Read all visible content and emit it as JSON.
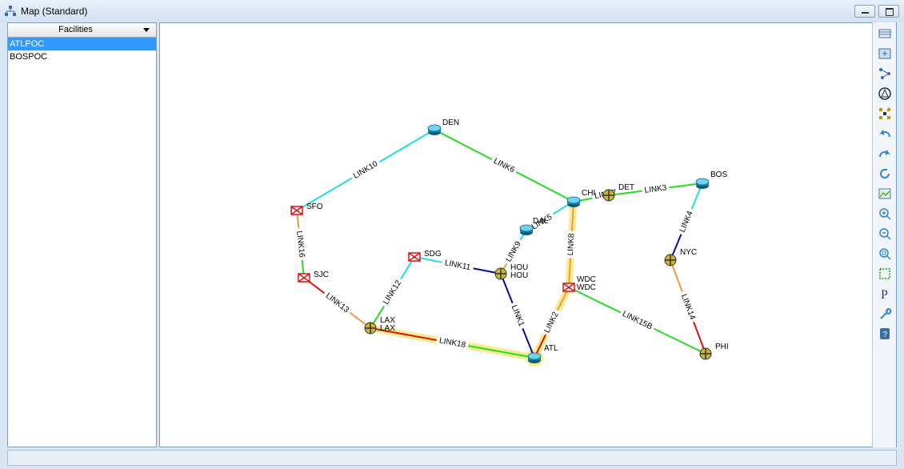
{
  "window": {
    "title": "Map (Standard)"
  },
  "facilities": {
    "dropdown_label": "Facilities",
    "items": [
      "ATLPOC",
      "BOSPOC"
    ],
    "selected": "ATLPOC"
  },
  "colors": {
    "green": "#22dd22",
    "cyan": "#22dddd",
    "blue": "#0a0a99",
    "orange": "#f09a40",
    "red": "#dd1111",
    "highlight": "#f7ec90",
    "selection": "#3399ff"
  },
  "map": {
    "nodes": [
      {
        "id": "DEN",
        "label": "DEN",
        "type": "router"
      },
      {
        "id": "SFO",
        "label": "SFO",
        "type": "switch"
      },
      {
        "id": "SJC",
        "label": "SJC",
        "type": "switch"
      },
      {
        "id": "LAX",
        "label": "LAX",
        "label2": "LAX",
        "type": "cross"
      },
      {
        "id": "SDG",
        "label": "SDG",
        "type": "switch"
      },
      {
        "id": "HOU",
        "label": "HOU",
        "label2": "HOU",
        "type": "cross"
      },
      {
        "id": "DAL",
        "label": "DAL",
        "type": "router"
      },
      {
        "id": "CHI",
        "label": "CHI",
        "type": "router"
      },
      {
        "id": "DET",
        "label": "DET",
        "type": "cross"
      },
      {
        "id": "BOS",
        "label": "BOS",
        "type": "router"
      },
      {
        "id": "NYC",
        "label": "NYC",
        "type": "cross"
      },
      {
        "id": "WDC",
        "label": "WDC",
        "label2": "WDC",
        "type": "switch"
      },
      {
        "id": "ATL",
        "label": "ATL",
        "type": "router"
      },
      {
        "id": "PHI",
        "label": "PHI",
        "type": "cross"
      }
    ],
    "links": [
      {
        "name": "LINK10",
        "from": "SFO",
        "to": "DEN",
        "color": "cyan"
      },
      {
        "name": "LINK6",
        "from": "DEN",
        "to": "CHI",
        "color": "green"
      },
      {
        "name": "LINK16",
        "from": "SFO",
        "to": "SJC",
        "color": "orange",
        "color2": "green"
      },
      {
        "name": "LINK13",
        "from": "SJC",
        "to": "LAX",
        "color": "red",
        "color2": "orange"
      },
      {
        "name": "LINK12",
        "from": "LAX",
        "to": "SDG",
        "color": "green",
        "color2": "cyan"
      },
      {
        "name": "LINK18",
        "from": "LAX",
        "to": "ATL",
        "color": "red",
        "color2": "green",
        "highlight": true
      },
      {
        "name": "LINK11",
        "from": "SDG",
        "to": "HOU",
        "color": "cyan",
        "color2": "blue"
      },
      {
        "name": "LINK9",
        "from": "HOU",
        "to": "DAL",
        "color": "orange",
        "color2": "cyan"
      },
      {
        "name": "LINK1",
        "from": "HOU",
        "to": "ATL",
        "color": "blue",
        "color2": "blue"
      },
      {
        "name": "LINK5",
        "from": "DAL",
        "to": "CHI",
        "color": "green",
        "color2": "cyan"
      },
      {
        "name": "LINK7",
        "from": "CHI",
        "to": "DET",
        "color": "green"
      },
      {
        "name": "LINK3",
        "from": "DET",
        "to": "BOS",
        "color": "green"
      },
      {
        "name": "LINK8",
        "from": "CHI",
        "to": "WDC",
        "color": "orange",
        "highlight": true
      },
      {
        "name": "LINK2",
        "from": "WDC",
        "to": "ATL",
        "color": "orange",
        "color2": "red",
        "highlight": true
      },
      {
        "name": "LINK4",
        "from": "BOS",
        "to": "NYC",
        "color": "cyan",
        "color2": "blue"
      },
      {
        "name": "LINK14",
        "from": "NYC",
        "to": "PHI",
        "color": "orange",
        "color2": "red"
      },
      {
        "name": "LINK15B",
        "from": "WDC",
        "to": "PHI",
        "color": "green"
      }
    ]
  },
  "toolbar": {
    "tools": [
      "grid-icon",
      "fit-view-icon",
      "topology-icon",
      "node-layout-icon",
      "tree-layout-icon",
      "undo-icon",
      "redo-icon",
      "refresh-icon",
      "map-image-icon",
      "zoom-in-icon",
      "zoom-out-icon",
      "zoom-fit-icon",
      "select-region-icon",
      "properties-icon",
      "settings-wrench-icon",
      "help-icon"
    ]
  },
  "status": {
    "text": ""
  }
}
